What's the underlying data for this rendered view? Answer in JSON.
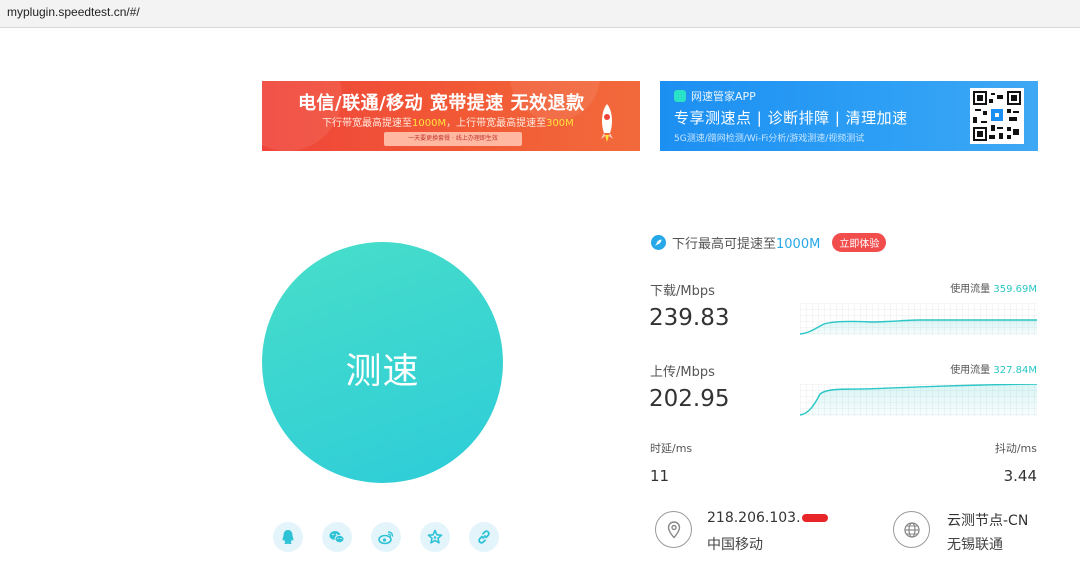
{
  "browser": {
    "url": "myplugin.speedtest.cn/#/"
  },
  "banners": {
    "left": {
      "headline": "电信/联通/移动 宽带提速 无效退款",
      "sub_pre": "下行带宽最高提速至",
      "sub_hl1": "1000M",
      "sub_mid": "，上行带宽最高提速至",
      "sub_hl2": "300M",
      "strip": "一天要更换套餐 · 线上办理即生效"
    },
    "right": {
      "app_name": "网速管家APP",
      "headline": "专享测速点 | 诊断排障 | 清理加速",
      "sub": "5G测速/蹭网检测/Wi-Fi分析/游戏测速/视频测试"
    }
  },
  "start_button": {
    "label": "测速"
  },
  "promo": {
    "pre": "下行最高可提速至",
    "highlight": "1000M",
    "cta": "立即体验"
  },
  "download": {
    "label": "下载/Mbps",
    "value": "239.83",
    "usage_label": "使用流量",
    "usage_value": "359.69M"
  },
  "upload": {
    "label": "上传/Mbps",
    "value": "202.95",
    "usage_label": "使用流量",
    "usage_value": "327.84M"
  },
  "latency": {
    "label": "时延/ms",
    "value": "11"
  },
  "jitter": {
    "label": "抖动/ms",
    "value": "3.44"
  },
  "client": {
    "ip": "218.206.103.",
    "isp": "中国移动"
  },
  "server": {
    "name": "云测节点-CN",
    "location": "无锡联通"
  },
  "colors": {
    "accent": "#2dccd9",
    "usage": "#2bc6c6",
    "promo": "#26a8e8",
    "cta": "#f24d4d",
    "banner_left": "#f0443a",
    "banner_right": "#1c8ff2"
  },
  "icons": {
    "share": [
      "qq-icon",
      "wechat-icon",
      "weibo-icon",
      "favorite-star-icon",
      "link-icon"
    ],
    "client": "location-pin-icon",
    "server": "globe-icon",
    "promo": "rocket-icon"
  }
}
